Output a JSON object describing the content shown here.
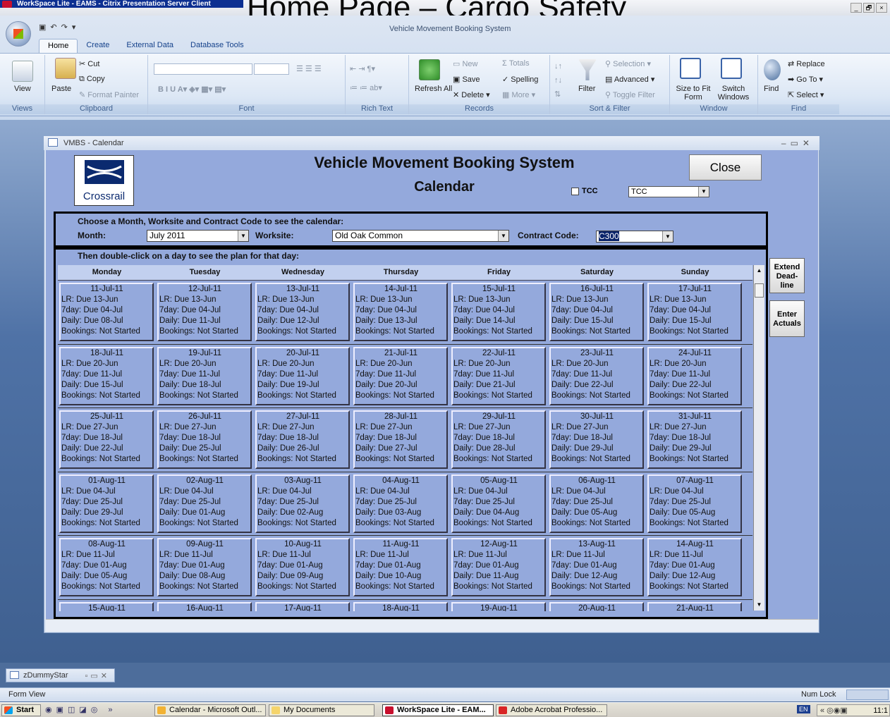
{
  "citrix": {
    "window_title": "WorkSpace Lite - EAMS - Citrix Presentation Server Client",
    "background_text": "Home Page – Cargo Safety",
    "controls": [
      "_",
      "🗗",
      "×"
    ]
  },
  "access": {
    "title": "Vehicle Movement Booking System",
    "tabs": [
      "Home",
      "Create",
      "External Data",
      "Database Tools"
    ],
    "groups": {
      "views": {
        "label": "Views",
        "view": "View"
      },
      "clipboard": {
        "label": "Clipboard",
        "paste": "Paste",
        "cut": "Cut",
        "copy": "Copy",
        "format_painter": "Format Painter"
      },
      "font": {
        "label": "Font"
      },
      "rich_text": {
        "label": "Rich Text"
      },
      "records": {
        "label": "Records",
        "refresh": "Refresh All",
        "new": "New",
        "save": "Save",
        "delete": "Delete",
        "totals": "Totals",
        "spelling": "Spelling",
        "more": "More"
      },
      "sort_filter": {
        "label": "Sort & Filter",
        "filter": "Filter",
        "selection": "Selection",
        "advanced": "Advanced",
        "toggle": "Toggle Filter"
      },
      "window": {
        "label": "Window",
        "size_to_fit": "Size to Fit Form",
        "switch": "Switch Windows"
      },
      "find": {
        "label": "Find",
        "find": "Find",
        "replace": "Replace",
        "goto": "Go To",
        "select": "Select"
      }
    }
  },
  "form": {
    "window_title": "VMBS - Calendar",
    "logo_text": "Crossrail",
    "system_title": "Vehicle Movement Booking System",
    "subtitle": "Calendar",
    "close_label": "Close",
    "tcc_label": "TCC",
    "tcc_value": "TCC",
    "filter_heading": "Choose a Month, Worksite and Contract Code to see the calendar:",
    "month_label": "Month:",
    "month_value": "July 2011",
    "worksite_label": "Worksite:",
    "worksite_value": "Old Oak Common",
    "contract_label": "Contract Code:",
    "contract_value": "C300",
    "grid_heading": "Then double-click on a day to see the plan for that day:",
    "side_buttons": {
      "extend": "Extend Dead-line",
      "actuals": "Enter Actuals"
    },
    "days": [
      "Monday",
      "Tuesday",
      "Wednesday",
      "Thursday",
      "Friday",
      "Saturday",
      "Sunday"
    ],
    "weeks": [
      [
        {
          "date": "11-Jul-11",
          "lr": "LR:  Due 13-Jun",
          "seven": "7day: Due 04-Jul",
          "daily": "Daily: Due 08-Jul",
          "bookings": "Bookings: Not Started"
        },
        {
          "date": "12-Jul-11",
          "lr": "LR:  Due 13-Jun",
          "seven": "7day: Due 04-Jul",
          "daily": "Daily: Due 11-Jul",
          "bookings": "Bookings: Not Started"
        },
        {
          "date": "13-Jul-11",
          "lr": "LR:  Due 13-Jun",
          "seven": "7day: Due 04-Jul",
          "daily": "Daily: Due 12-Jul",
          "bookings": "Bookings: Not Started"
        },
        {
          "date": "14-Jul-11",
          "lr": "LR:  Due 13-Jun",
          "seven": "7day: Due 04-Jul",
          "daily": "Daily: Due 13-Jul",
          "bookings": "Bookings: Not Started"
        },
        {
          "date": "15-Jul-11",
          "lr": "LR:  Due 13-Jun",
          "seven": "7day: Due 04-Jul",
          "daily": "Daily: Due 14-Jul",
          "bookings": "Bookings: Not Started"
        },
        {
          "date": "16-Jul-11",
          "lr": "LR:  Due 13-Jun",
          "seven": "7day: Due 04-Jul",
          "daily": "Daily: Due 15-Jul",
          "bookings": "Bookings: Not Started"
        },
        {
          "date": "17-Jul-11",
          "lr": "LR:  Due 13-Jun",
          "seven": "7day: Due 04-Jul",
          "daily": "Daily: Due 15-Jul",
          "bookings": "Bookings: Not Started"
        }
      ],
      [
        {
          "date": "18-Jul-11",
          "lr": "LR:  Due 20-Jun",
          "seven": "7day: Due 11-Jul",
          "daily": "Daily: Due 15-Jul",
          "bookings": "Bookings: Not Started"
        },
        {
          "date": "19-Jul-11",
          "lr": "LR:  Due 20-Jun",
          "seven": "7day: Due 11-Jul",
          "daily": "Daily: Due 18-Jul",
          "bookings": "Bookings: Not Started"
        },
        {
          "date": "20-Jul-11",
          "lr": "LR:  Due 20-Jun",
          "seven": "7day: Due 11-Jul",
          "daily": "Daily: Due 19-Jul",
          "bookings": "Bookings: Not Started"
        },
        {
          "date": "21-Jul-11",
          "lr": "LR:  Due 20-Jun",
          "seven": "7day: Due 11-Jul",
          "daily": "Daily: Due 20-Jul",
          "bookings": "Bookings: Not Started"
        },
        {
          "date": "22-Jul-11",
          "lr": "LR:  Due 20-Jun",
          "seven": "7day: Due 11-Jul",
          "daily": "Daily: Due 21-Jul",
          "bookings": "Bookings: Not Started"
        },
        {
          "date": "23-Jul-11",
          "lr": "LR:  Due 20-Jun",
          "seven": "7day: Due 11-Jul",
          "daily": "Daily: Due 22-Jul",
          "bookings": "Bookings: Not Started"
        },
        {
          "date": "24-Jul-11",
          "lr": "LR:  Due 20-Jun",
          "seven": "7day: Due 11-Jul",
          "daily": "Daily: Due 22-Jul",
          "bookings": "Bookings: Not Started"
        }
      ],
      [
        {
          "date": "25-Jul-11",
          "lr": "LR:  Due 27-Jun",
          "seven": "7day: Due 18-Jul",
          "daily": "Daily: Due 22-Jul",
          "bookings": "Bookings: Not Started"
        },
        {
          "date": "26-Jul-11",
          "lr": "LR:  Due 27-Jun",
          "seven": "7day: Due 18-Jul",
          "daily": "Daily: Due 25-Jul",
          "bookings": "Bookings: Not Started"
        },
        {
          "date": "27-Jul-11",
          "lr": "LR:  Due 27-Jun",
          "seven": "7day: Due 18-Jul",
          "daily": "Daily: Due 26-Jul",
          "bookings": "Bookings: Not Started"
        },
        {
          "date": "28-Jul-11",
          "lr": "LR:  Due 27-Jun",
          "seven": "7day: Due 18-Jul",
          "daily": "Daily: Due 27-Jul",
          "bookings": "Bookings: Not Started"
        },
        {
          "date": "29-Jul-11",
          "lr": "LR:  Due 27-Jun",
          "seven": "7day: Due 18-Jul",
          "daily": "Daily: Due 28-Jul",
          "bookings": "Bookings: Not Started"
        },
        {
          "date": "30-Jul-11",
          "lr": "LR:  Due 27-Jun",
          "seven": "7day: Due 18-Jul",
          "daily": "Daily: Due 29-Jul",
          "bookings": "Bookings: Not Started"
        },
        {
          "date": "31-Jul-11",
          "lr": "LR:  Due 27-Jun",
          "seven": "7day: Due 18-Jul",
          "daily": "Daily: Due 29-Jul",
          "bookings": "Bookings: Not Started"
        }
      ],
      [
        {
          "date": "01-Aug-11",
          "lr": "LR:  Due 04-Jul",
          "seven": "7day: Due 25-Jul",
          "daily": "Daily: Due 29-Jul",
          "bookings": "Bookings: Not Started"
        },
        {
          "date": "02-Aug-11",
          "lr": "LR:  Due 04-Jul",
          "seven": "7day: Due 25-Jul",
          "daily": "Daily: Due 01-Aug",
          "bookings": "Bookings: Not Started"
        },
        {
          "date": "03-Aug-11",
          "lr": "LR:  Due 04-Jul",
          "seven": "7day: Due 25-Jul",
          "daily": "Daily: Due 02-Aug",
          "bookings": "Bookings: Not Started"
        },
        {
          "date": "04-Aug-11",
          "lr": "LR:  Due 04-Jul",
          "seven": "7day: Due 25-Jul",
          "daily": "Daily: Due 03-Aug",
          "bookings": "Bookings: Not Started"
        },
        {
          "date": "05-Aug-11",
          "lr": "LR:  Due 04-Jul",
          "seven": "7day: Due 25-Jul",
          "daily": "Daily: Due 04-Aug",
          "bookings": "Bookings: Not Started"
        },
        {
          "date": "06-Aug-11",
          "lr": "LR:  Due 04-Jul",
          "seven": "7day: Due 25-Jul",
          "daily": "Daily: Due 05-Aug",
          "bookings": "Bookings: Not Started"
        },
        {
          "date": "07-Aug-11",
          "lr": "LR:  Due 04-Jul",
          "seven": "7day: Due 25-Jul",
          "daily": "Daily: Due 05-Aug",
          "bookings": "Bookings: Not Started"
        }
      ],
      [
        {
          "date": "08-Aug-11",
          "lr": "LR:  Due 11-Jul",
          "seven": "7day: Due 01-Aug",
          "daily": "Daily: Due 05-Aug",
          "bookings": "Bookings: Not Started"
        },
        {
          "date": "09-Aug-11",
          "lr": "LR:  Due 11-Jul",
          "seven": "7day: Due 01-Aug",
          "daily": "Daily: Due 08-Aug",
          "bookings": "Bookings: Not Started"
        },
        {
          "date": "10-Aug-11",
          "lr": "LR:  Due 11-Jul",
          "seven": "7day: Due 01-Aug",
          "daily": "Daily: Due 09-Aug",
          "bookings": "Bookings: Not Started"
        },
        {
          "date": "11-Aug-11",
          "lr": "LR:  Due 11-Jul",
          "seven": "7day: Due 01-Aug",
          "daily": "Daily: Due 10-Aug",
          "bookings": "Bookings: Not Started"
        },
        {
          "date": "12-Aug-11",
          "lr": "LR:  Due 11-Jul",
          "seven": "7day: Due 01-Aug",
          "daily": "Daily: Due 11-Aug",
          "bookings": "Bookings: Not Started"
        },
        {
          "date": "13-Aug-11",
          "lr": "LR:  Due 11-Jul",
          "seven": "7day: Due 01-Aug",
          "daily": "Daily: Due 12-Aug",
          "bookings": "Bookings: Not Started"
        },
        {
          "date": "14-Aug-11",
          "lr": "LR:  Due 11-Jul",
          "seven": "7day: Due 01-Aug",
          "daily": "Daily: Due 12-Aug",
          "bookings": "Bookings: Not Started"
        }
      ],
      [
        {
          "date": "15-Aug-11"
        },
        {
          "date": "16-Aug-11"
        },
        {
          "date": "17-Aug-11"
        },
        {
          "date": "18-Aug-11"
        },
        {
          "date": "19-Aug-11"
        },
        {
          "date": "20-Aug-11"
        },
        {
          "date": "21-Aug-11"
        }
      ]
    ]
  },
  "mini_window": {
    "title": "zDummyStar"
  },
  "statusbar": {
    "left": "Form View",
    "right": "Num Lock"
  },
  "taskbar": {
    "start": "Start",
    "items": [
      "Calendar - Microsoft Outl...",
      "My Documents",
      "WorkSpace Lite - EAM...",
      "Adobe Acrobat Professio..."
    ],
    "lang": "EN",
    "clock": "11:1"
  }
}
